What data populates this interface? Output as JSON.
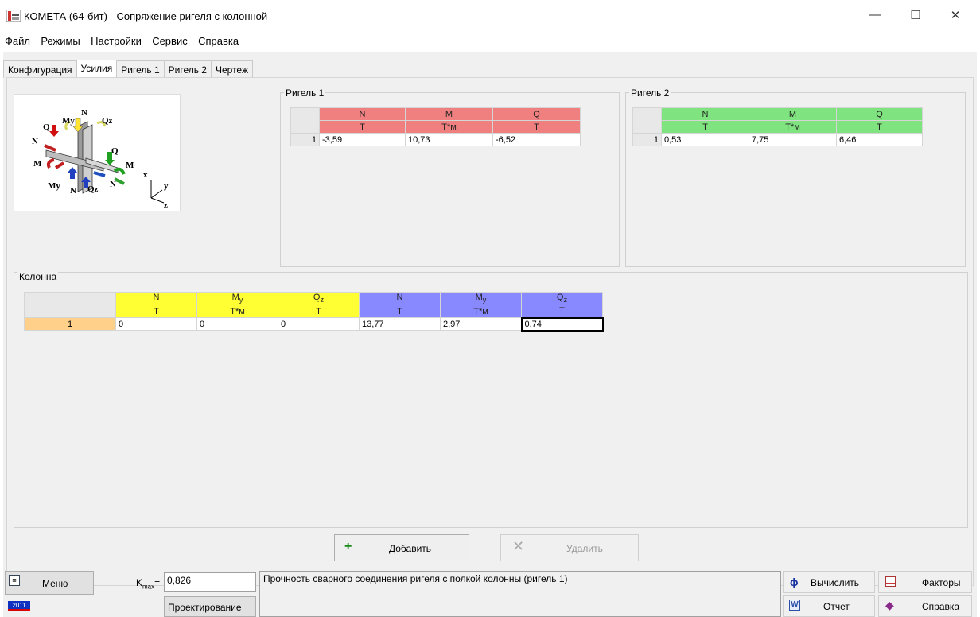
{
  "window": {
    "title": "КОМЕТА (64-бит) - Сопряжение ригеля с колонной",
    "minimize": "—",
    "maximize": "☐",
    "close": "✕"
  },
  "menu": [
    "Файл",
    "Режимы",
    "Настройки",
    "Сервис",
    "Справка"
  ],
  "tabs": [
    {
      "label": "Конфигурация",
      "active": false
    },
    {
      "label": "Усилия",
      "active": true
    },
    {
      "label": "Ригель 1",
      "active": false
    },
    {
      "label": "Ригель 2",
      "active": false
    },
    {
      "label": "Чертеж",
      "active": false
    }
  ],
  "diagram_labels": {
    "N_top": "N",
    "My_top": "My",
    "Qz_top": "Qz",
    "Q_left": "Q",
    "N_left": "N",
    "Q_right": "Q",
    "M_right": "M",
    "M_left": "M",
    "My_bottom": "My",
    "N_bottom": "N",
    "Qz_bottom": "Qz",
    "N_bottom_right": "N",
    "axis_x": "x",
    "axis_y": "y",
    "axis_z": "z"
  },
  "rigel1": {
    "title": "Ригель 1",
    "headers": [
      "N",
      "M",
      "Q"
    ],
    "units": [
      "Т",
      "Т*м",
      "Т"
    ],
    "row_num": "1",
    "values": [
      "-3,59",
      "10,73",
      "-6,52"
    ],
    "color": "#f08080"
  },
  "rigel2": {
    "title": "Ригель 2",
    "headers": [
      "N",
      "M",
      "Q"
    ],
    "units": [
      "Т",
      "Т*м",
      "Т"
    ],
    "row_num": "1",
    "values": [
      "0,53",
      "7,75",
      "6,46"
    ],
    "color": "#7fe37f"
  },
  "column": {
    "title": "Колонна",
    "headers": [
      {
        "base": "N",
        "sub": ""
      },
      {
        "base": "M",
        "sub": "y"
      },
      {
        "base": "Q",
        "sub": "z"
      },
      {
        "base": "N",
        "sub": ""
      },
      {
        "base": "M",
        "sub": "y"
      },
      {
        "base": "Q",
        "sub": "z"
      }
    ],
    "units": [
      "Т",
      "Т*м",
      "Т",
      "Т",
      "Т*м",
      "Т"
    ],
    "row_num": "1",
    "values": [
      "0",
      "0",
      "0",
      "13,77",
      "2,97",
      "0,74"
    ]
  },
  "actions": {
    "add_label": "Добавить",
    "delete_label": "Удалить"
  },
  "bottom": {
    "menu_label": "Меню",
    "year_badge": "2011",
    "kmax_label": "K",
    "kmax_sub": "max",
    "kmax_eq": "=",
    "kmax_value": "0,826",
    "design_label": "Проектирование",
    "status_text": "Прочность сварного соединения ригеля с полкой колонны (ригель 1)",
    "calc_label": "Вычислить",
    "report_label": "Отчет",
    "factors_label": "Факторы",
    "help_label": "Справка"
  }
}
